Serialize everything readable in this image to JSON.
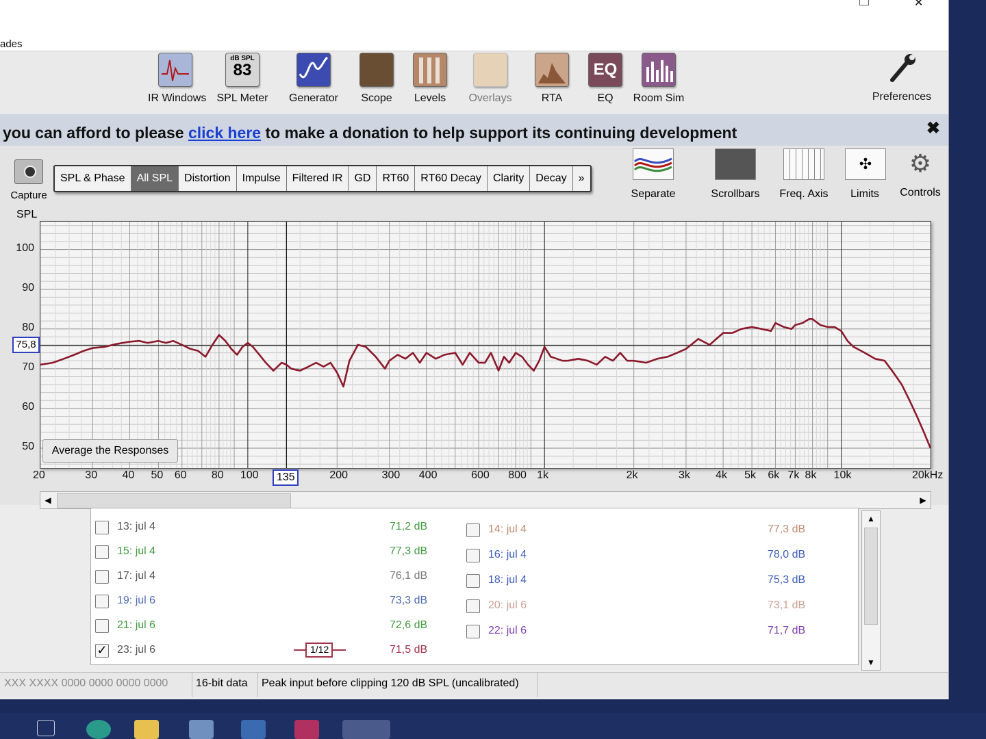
{
  "menubar": {
    "text": "ades"
  },
  "toolbar": {
    "items": [
      {
        "label": "IR Windows",
        "icon": "ir-windows-icon",
        "enabled": true
      },
      {
        "label": "SPL Meter",
        "icon": "spl-meter-icon",
        "enabled": true,
        "badge_top": "dB SPL",
        "badge_value": "83"
      },
      {
        "label": "Generator",
        "icon": "generator-icon",
        "enabled": true
      },
      {
        "label": "Scope",
        "icon": "scope-icon",
        "enabled": true
      },
      {
        "label": "Levels",
        "icon": "levels-icon",
        "enabled": true
      },
      {
        "label": "Overlays",
        "icon": "overlays-icon",
        "enabled": false
      },
      {
        "label": "RTA",
        "icon": "rta-icon",
        "enabled": true
      },
      {
        "label": "EQ",
        "icon": "eq-icon",
        "enabled": true
      },
      {
        "label": "Room Sim",
        "icon": "room-sim-icon",
        "enabled": true
      }
    ],
    "preferences_label": "Preferences"
  },
  "donation": {
    "prefix": "you can afford to please ",
    "link": "click here",
    "suffix": " to make a donation to help support its continuing development",
    "close": "✖"
  },
  "capture_label": "Capture",
  "tabs": [
    {
      "label": "SPL & Phase",
      "active": false
    },
    {
      "label": "All SPL",
      "active": true
    },
    {
      "label": "Distortion",
      "active": false
    },
    {
      "label": "Impulse",
      "active": false
    },
    {
      "label": "Filtered IR",
      "active": false
    },
    {
      "label": "GD",
      "active": false
    },
    {
      "label": "RT60",
      "active": false
    },
    {
      "label": "RT60 Decay",
      "active": false
    },
    {
      "label": "Clarity",
      "active": false
    },
    {
      "label": "Decay",
      "active": false
    },
    {
      "label": "»",
      "active": false
    }
  ],
  "right_tools": [
    {
      "label": "Separate",
      "icon": "separate-icon"
    },
    {
      "label": "Scrollbars",
      "icon": "scrollbars-icon"
    },
    {
      "label": "Freq. Axis",
      "icon": "freq-axis-icon"
    },
    {
      "label": "Limits",
      "icon": "limits-icon"
    },
    {
      "label": "Controls",
      "icon": "controls-gear-icon"
    }
  ],
  "chart_data": {
    "type": "line",
    "ylabel": "SPL",
    "xscale": "log",
    "xlim": [
      20,
      20000
    ],
    "ylim": [
      45,
      107
    ],
    "yticks": [
      100,
      90,
      80,
      70,
      60,
      50
    ],
    "xticks": [
      {
        "v": 20,
        "l": "20"
      },
      {
        "v": 30,
        "l": "30"
      },
      {
        "v": 40,
        "l": "40"
      },
      {
        "v": 50,
        "l": "50"
      },
      {
        "v": 60,
        "l": "60"
      },
      {
        "v": 80,
        "l": "80"
      },
      {
        "v": 100,
        "l": "100"
      },
      {
        "v": 200,
        "l": "200"
      },
      {
        "v": 300,
        "l": "300"
      },
      {
        "v": 400,
        "l": "400"
      },
      {
        "v": 600,
        "l": "600"
      },
      {
        "v": 800,
        "l": "800"
      },
      {
        "v": 1000,
        "l": "1k"
      },
      {
        "v": 2000,
        "l": "2k"
      },
      {
        "v": 3000,
        "l": "3k"
      },
      {
        "v": 4000,
        "l": "4k"
      },
      {
        "v": 5000,
        "l": "5k"
      },
      {
        "v": 6000,
        "l": "6k"
      },
      {
        "v": 7000,
        "l": "7k"
      },
      {
        "v": 8000,
        "l": "8k"
      },
      {
        "v": 10000,
        "l": "10k"
      },
      {
        "v": 20000,
        "l": "20kHz"
      }
    ],
    "cursor": {
      "x": 135,
      "x_label": "135",
      "y": 75.8,
      "y_label": "75,8"
    },
    "grid": true,
    "series": [
      {
        "color": "#8b1a2b",
        "x": [
          20,
          22,
          24,
          26,
          28,
          30,
          33,
          36,
          40,
          43,
          46,
          50,
          53,
          56,
          60,
          64,
          68,
          72,
          76,
          80,
          84,
          88,
          92,
          96,
          100,
          104,
          108,
          115,
          122,
          130,
          135,
          140,
          150,
          160,
          170,
          180,
          190,
          200,
          210,
          220,
          235,
          250,
          270,
          290,
          300,
          320,
          340,
          360,
          380,
          400,
          430,
          460,
          500,
          530,
          560,
          600,
          630,
          660,
          700,
          730,
          760,
          800,
          840,
          880,
          920,
          960,
          1000,
          1050,
          1100,
          1150,
          1200,
          1300,
          1400,
          1500,
          1600,
          1700,
          1800,
          1900,
          2000,
          2200,
          2400,
          2600,
          2800,
          3000,
          3300,
          3600,
          4000,
          4300,
          4600,
          5000,
          5400,
          5800,
          6000,
          6400,
          6800,
          7000,
          7400,
          7800,
          8000,
          8500,
          9000,
          9500,
          10000,
          10500,
          11000,
          12000,
          13000,
          14000,
          15000,
          16000,
          17000,
          18000,
          19000,
          20000
        ],
        "y": [
          71,
          71.5,
          72.5,
          73.5,
          74.5,
          75.2,
          75.5,
          76.2,
          76.8,
          77,
          76.5,
          77,
          76.5,
          77,
          76,
          75,
          74.5,
          73,
          76,
          78.5,
          77,
          75,
          73.5,
          75.5,
          76.5,
          75.5,
          74,
          71.5,
          69.5,
          71.5,
          71,
          70,
          69.5,
          70.5,
          71.5,
          70.5,
          71.5,
          69,
          65.5,
          72,
          76,
          75.5,
          73,
          70,
          72,
          73.5,
          72.5,
          74,
          71.5,
          74,
          72.5,
          73.5,
          74,
          71,
          74,
          71.5,
          71.5,
          74,
          69.5,
          73,
          71.5,
          74,
          73,
          71,
          69.5,
          72,
          75.5,
          73,
          72.5,
          72,
          72,
          72.5,
          72,
          71,
          73,
          72,
          74,
          72,
          72,
          71.5,
          72.5,
          73,
          74,
          75,
          77.5,
          76,
          79,
          79,
          80,
          80.5,
          80,
          79.5,
          81.5,
          80.5,
          80,
          81,
          81.5,
          82.5,
          82.5,
          81,
          80.5,
          80.5,
          79.5,
          77,
          75.5,
          74,
          72.5,
          72,
          69,
          66,
          62,
          58,
          54,
          50
        ]
      }
    ]
  },
  "avg_button": "Average the Responses",
  "measurements": {
    "left": [
      {
        "label": "13: jul 4",
        "db": "71,2 dB",
        "checked": false,
        "name_color": "#555",
        "db_color": "#3f9a3f"
      },
      {
        "label": "15: jul 4",
        "db": "77,3 dB",
        "checked": false,
        "name_color": "#3f9a3f",
        "db_color": "#3f9a3f"
      },
      {
        "label": "17: jul 4",
        "db": "76,1 dB",
        "checked": false,
        "name_color": "#555",
        "db_color": "#7a7a7a"
      },
      {
        "label": "19: jul 6",
        "db": "73,3 dB",
        "checked": false,
        "name_color": "#4d6bb0",
        "db_color": "#4d6bb0"
      },
      {
        "label": "21: jul 6",
        "db": "72,6 dB",
        "checked": false,
        "name_color": "#3f9a3f",
        "db_color": "#3f9a3f"
      },
      {
        "label": "23: jul 6",
        "db": "71,5 dB",
        "checked": true,
        "name_color": "#555",
        "db_color": "#a0324a"
      }
    ],
    "right": [
      {
        "label": "14: jul 4",
        "db": "77,3 dB",
        "checked": false,
        "name_color": "#c08a70",
        "db_color": "#c08a70"
      },
      {
        "label": "16: jul 4",
        "db": "78,0 dB",
        "checked": false,
        "name_color": "#3a5dbb",
        "db_color": "#3a5dbb"
      },
      {
        "label": "18: jul 4",
        "db": "75,3 dB",
        "checked": false,
        "name_color": "#3a5dbb",
        "db_color": "#3a5dbb"
      },
      {
        "label": "20: jul 6",
        "db": "73,1 dB",
        "checked": false,
        "name_color": "#c8a090",
        "db_color": "#c8a090"
      },
      {
        "label": "22: jul 6",
        "db": "71,7 dB",
        "checked": false,
        "name_color": "#8040b0",
        "db_color": "#8040b0"
      }
    ],
    "smoothing_label": "1/12"
  },
  "status": {
    "c1": "XXX XXXX  0000 0000  0000 0000",
    "c2": "16-bit data",
    "c3": "Peak input before clipping 120 dB SPL (uncalibrated)"
  },
  "colors": {
    "curve": "#8b1a2b",
    "cursor": "#3040c0",
    "donate_link": "#1b3fd1"
  }
}
